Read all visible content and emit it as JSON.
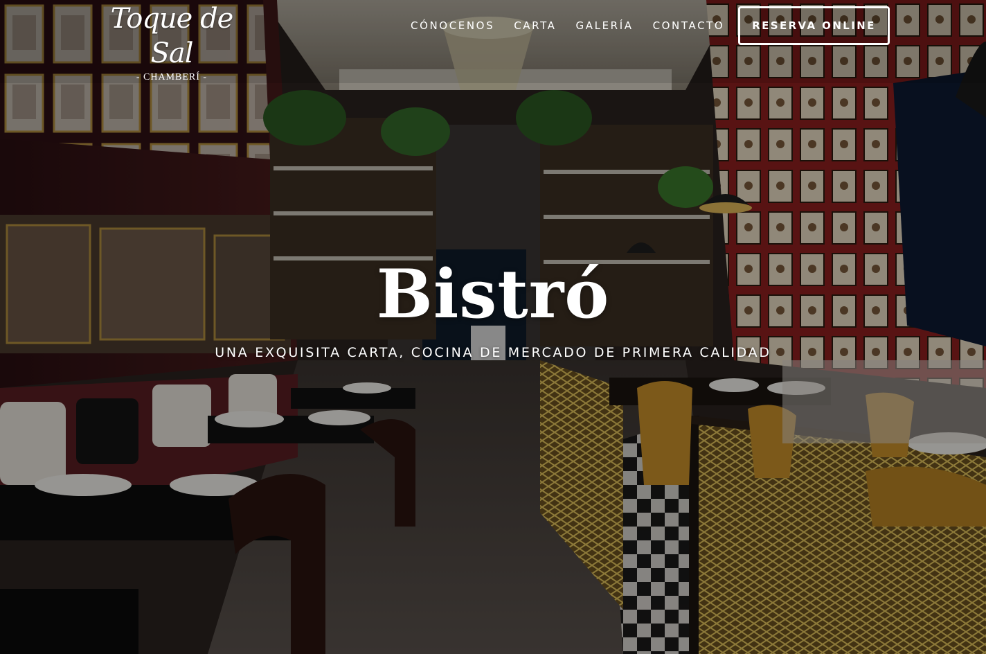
{
  "brand": {
    "logo_script": "Toque de Sal",
    "logo_sub": "- CHAMBERÍ -"
  },
  "nav": {
    "items": [
      {
        "label": "CÓNOCENOS"
      },
      {
        "label": "CARTA"
      },
      {
        "label": "GALERÍA"
      },
      {
        "label": "CONTACTO"
      }
    ],
    "cta_label": "RESERVA ONLINE"
  },
  "hero": {
    "title": "Bistró",
    "subtitle": "UNA EXQUISITA CARTA, COCINA DE MERCADO DE PRIMERA CALIDAD"
  },
  "colors": {
    "text": "#ffffff",
    "overlay": "#000000",
    "wall_red": "#8c1f1f",
    "gold": "#b8902f"
  }
}
